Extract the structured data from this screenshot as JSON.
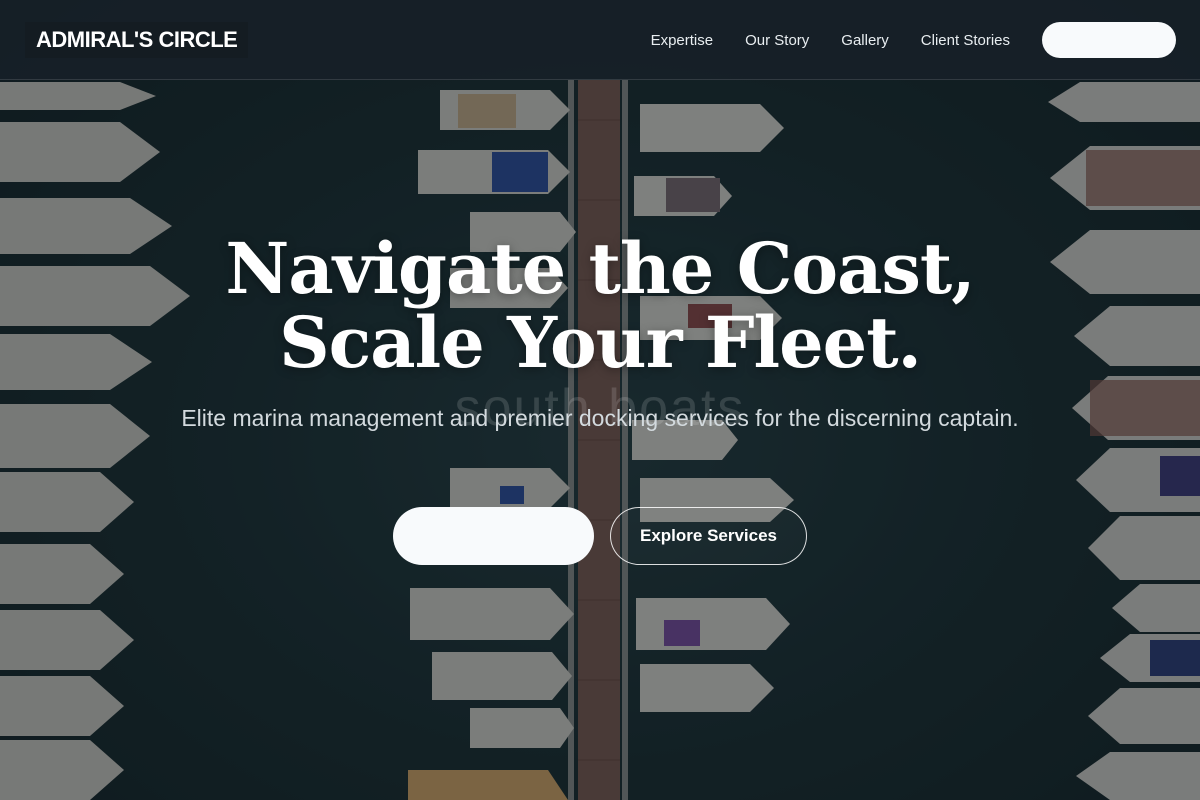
{
  "header": {
    "brand": "ADMIRAL'S CIRCLE",
    "nav": [
      {
        "label": "Expertise"
      },
      {
        "label": "Our Story"
      },
      {
        "label": "Gallery"
      },
      {
        "label": "Client Stories"
      }
    ],
    "cta_label": ""
  },
  "hero": {
    "title": "Navigate the Coast, Scale Your Fleet.",
    "subtitle": "Elite marina management and premier docking services for the discerning captain.",
    "primary_label": "",
    "secondary_label": "Explore Services",
    "background_overlay_text": "south boats"
  },
  "colors": {
    "header_bg": "#172028",
    "water": "#1d3337",
    "button_fill": "#f8fafc",
    "text_light": "#ffffff"
  }
}
